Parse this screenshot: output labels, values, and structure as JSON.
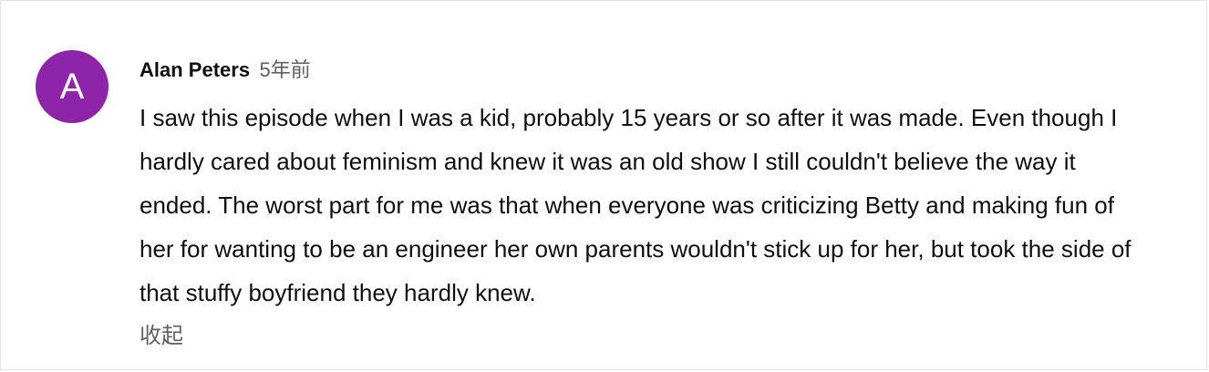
{
  "comment": {
    "avatar_letter": "A",
    "avatar_color": "#8e24aa",
    "author": "Alan Peters",
    "time": "5年前",
    "text": "I saw this episode when I was a kid, probably 15 years or so after it was made. Even though I hardly cared about feminism and knew it was an old show I still couldn't believe the way it ended. The worst part for me was that when everyone was criticizing Betty and making fun of her for wanting to be an engineer her own parents wouldn't stick up for her, but took the side of that stuffy boyfriend they hardly knew.",
    "collapse_label": "收起"
  }
}
